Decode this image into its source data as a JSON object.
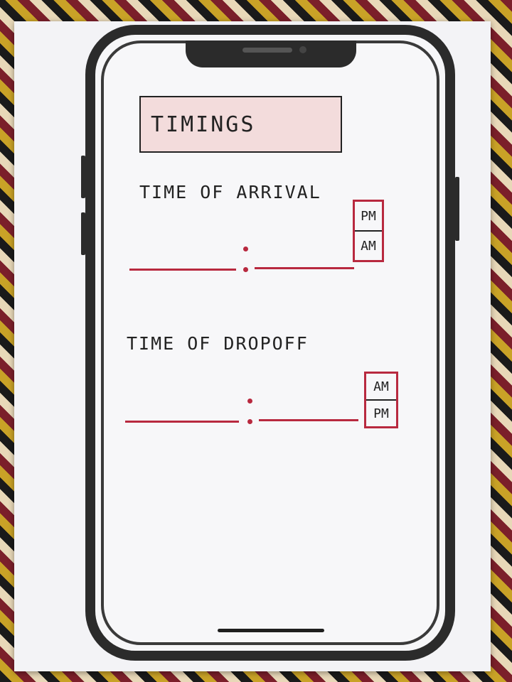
{
  "screen": {
    "title": "TIMINGS"
  },
  "arrival": {
    "label": "TIME OF ARRIVAL",
    "hour_value": "",
    "minute_value": "",
    "toggle_top": "PM",
    "toggle_bottom": "AM"
  },
  "dropoff": {
    "label": "TIME OF DROPOFF",
    "hour_value": "",
    "minute_value": "",
    "toggle_top": "AM",
    "toggle_bottom": "PM"
  },
  "colors": {
    "accent": "#b8293f",
    "title_fill": "#f3dcdc",
    "frame": "#2b2b2b"
  }
}
